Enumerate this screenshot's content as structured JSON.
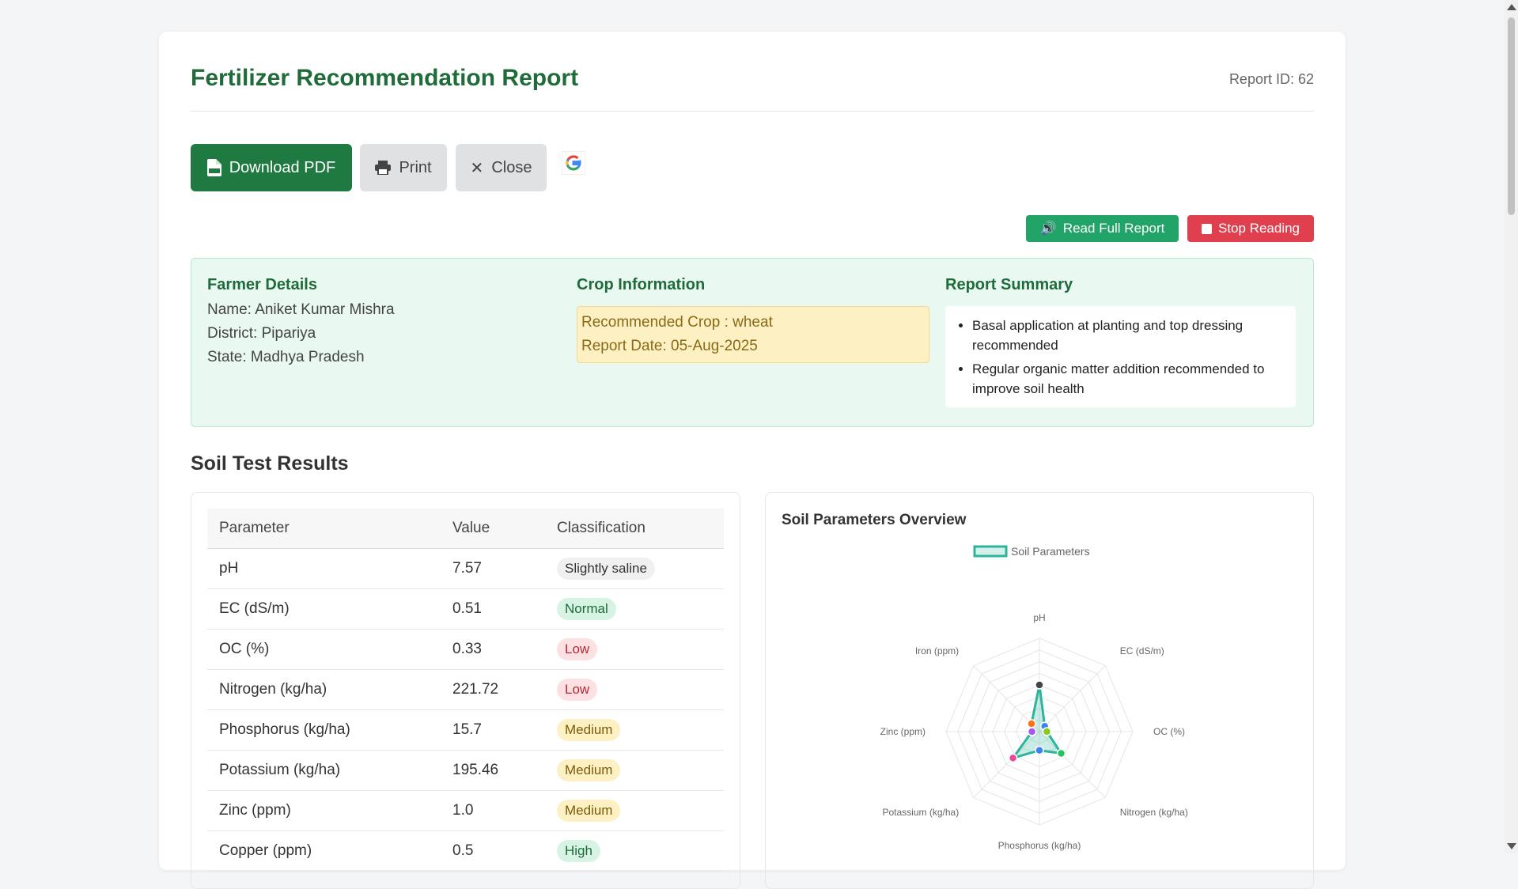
{
  "header": {
    "title": "Fertilizer Recommendation Report",
    "report_id": "Report ID: 62"
  },
  "actions": {
    "download_pdf": "Download PDF",
    "print": "Print",
    "close": "Close"
  },
  "tts": {
    "read": "Read Full Report",
    "stop": "Stop Reading"
  },
  "farmer": {
    "heading": "Farmer Details",
    "name": "Name: Aniket Kumar Mishra",
    "district": "District: Pipariya",
    "state": "State: Madhya Pradesh"
  },
  "crop": {
    "heading": "Crop Information",
    "recommended": "Recommended Crop : wheat",
    "date": "Report Date: 05-Aug-2025"
  },
  "summary": {
    "heading": "Report Summary",
    "items": [
      "Basal application at planting and top dressing recommended",
      "Regular organic matter addition recommended to improve soil health"
    ]
  },
  "soil": {
    "title": "Soil Test Results",
    "headers": [
      "Parameter",
      "Value",
      "Classification"
    ],
    "rows": [
      {
        "param": "pH",
        "value": "7.57",
        "class": "Slightly saline",
        "tone": "grey"
      },
      {
        "param": "EC (dS/m)",
        "value": "0.51",
        "class": "Normal",
        "tone": "green"
      },
      {
        "param": "OC (%)",
        "value": "0.33",
        "class": "Low",
        "tone": "red"
      },
      {
        "param": "Nitrogen (kg/ha)",
        "value": "221.72",
        "class": "Low",
        "tone": "red"
      },
      {
        "param": "Phosphorus (kg/ha)",
        "value": "15.7",
        "class": "Medium",
        "tone": "yellow"
      },
      {
        "param": "Potassium (kg/ha)",
        "value": "195.46",
        "class": "Medium",
        "tone": "yellow"
      },
      {
        "param": "Zinc (ppm)",
        "value": "1.0",
        "class": "Medium",
        "tone": "yellow"
      },
      {
        "param": "Copper (ppm)",
        "value": "0.5",
        "class": "High",
        "tone": "green"
      }
    ]
  },
  "chart_data": {
    "type": "radar",
    "title": "Soil Parameters Overview",
    "legend": "Soil Parameters",
    "axes": [
      "pH",
      "EC (dS/m)",
      "OC (%)",
      "Nitrogen (kg/ha)",
      "Phosphorus (kg/ha)",
      "Potassium (kg/ha)",
      "Zinc (ppm)",
      "Iron (ppm)"
    ],
    "values": [
      0.5,
      0.08,
      0.08,
      0.33,
      0.2,
      0.4,
      0.08,
      0.12
    ],
    "point_colors": [
      "#444444",
      "#3b82f6",
      "#84cc16",
      "#22c55e",
      "#3b82f6",
      "#ec4899",
      "#a855f7",
      "#f97316"
    ],
    "series_color": "#2bb59a",
    "levels": 8
  },
  "colors": {
    "brand": "#1f6b3a",
    "button_green": "#1e7a40",
    "tts_green": "#22a367",
    "tts_red": "#e0404d"
  }
}
